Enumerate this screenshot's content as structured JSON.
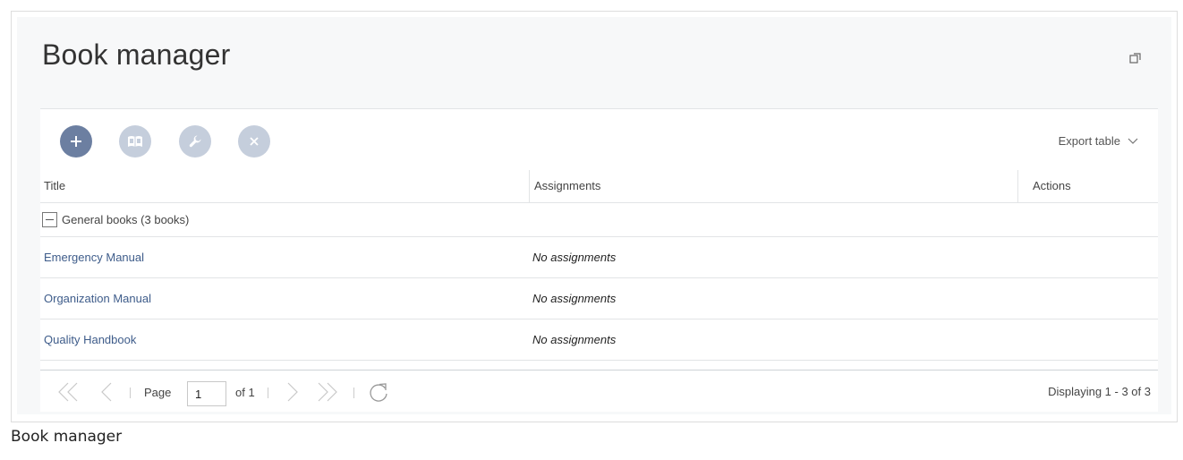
{
  "page": {
    "title": "Book manager",
    "caption": "Book manager"
  },
  "toolbar": {
    "buttons": [
      {
        "name": "add",
        "icon": "plus-icon",
        "color": "#6c7fa1"
      },
      {
        "name": "open",
        "icon": "book-icon",
        "color": "#c5cedc"
      },
      {
        "name": "edit",
        "icon": "wrench-icon",
        "color": "#c5cedc"
      },
      {
        "name": "delete",
        "icon": "close-icon",
        "color": "#c5cedc"
      }
    ],
    "export_label": "Export table"
  },
  "table": {
    "columns": [
      "Title",
      "Assignments",
      "Actions"
    ],
    "group": {
      "label": "General books (3 books)"
    },
    "rows": [
      {
        "title": "Emergency Manual",
        "assignments": "No assignments"
      },
      {
        "title": "Organization Manual",
        "assignments": "No assignments"
      },
      {
        "title": "Quality Handbook",
        "assignments": "No assignments"
      }
    ]
  },
  "pager": {
    "page_label": "Page",
    "page_value": "1",
    "of_label": "of 1",
    "displaying": "Displaying 1 - 3 of 3"
  },
  "colors": {
    "link": "#3e5c8a",
    "panel_bg": "#f7f8f9",
    "primary_button": "#6c7fa1",
    "disabled_button": "#c5cedc"
  }
}
